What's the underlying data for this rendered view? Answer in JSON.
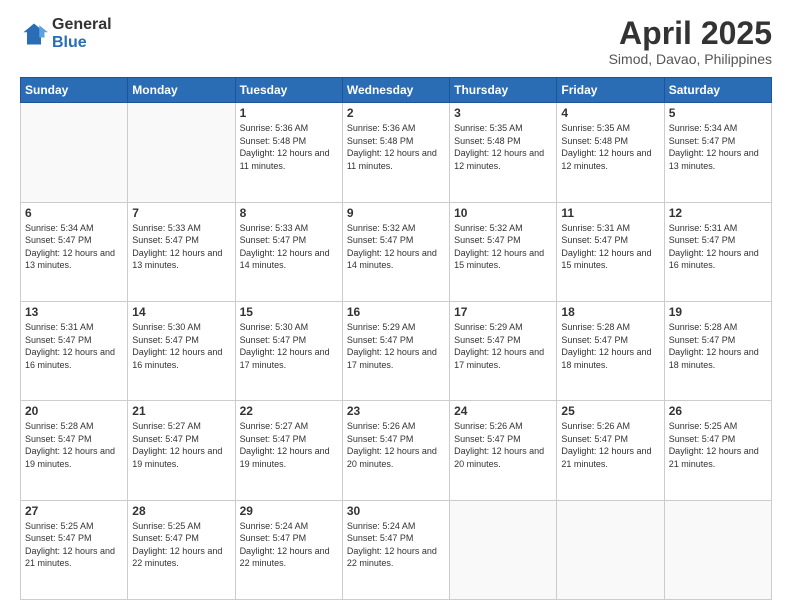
{
  "header": {
    "logo_general": "General",
    "logo_blue": "Blue",
    "title": "April 2025",
    "location": "Simod, Davao, Philippines"
  },
  "days_of_week": [
    "Sunday",
    "Monday",
    "Tuesday",
    "Wednesday",
    "Thursday",
    "Friday",
    "Saturday"
  ],
  "weeks": [
    [
      {
        "day": "",
        "sunrise": "",
        "sunset": "",
        "daylight": ""
      },
      {
        "day": "",
        "sunrise": "",
        "sunset": "",
        "daylight": ""
      },
      {
        "day": "1",
        "sunrise": "Sunrise: 5:36 AM",
        "sunset": "Sunset: 5:48 PM",
        "daylight": "Daylight: 12 hours and 11 minutes."
      },
      {
        "day": "2",
        "sunrise": "Sunrise: 5:36 AM",
        "sunset": "Sunset: 5:48 PM",
        "daylight": "Daylight: 12 hours and 11 minutes."
      },
      {
        "day": "3",
        "sunrise": "Sunrise: 5:35 AM",
        "sunset": "Sunset: 5:48 PM",
        "daylight": "Daylight: 12 hours and 12 minutes."
      },
      {
        "day": "4",
        "sunrise": "Sunrise: 5:35 AM",
        "sunset": "Sunset: 5:48 PM",
        "daylight": "Daylight: 12 hours and 12 minutes."
      },
      {
        "day": "5",
        "sunrise": "Sunrise: 5:34 AM",
        "sunset": "Sunset: 5:47 PM",
        "daylight": "Daylight: 12 hours and 13 minutes."
      }
    ],
    [
      {
        "day": "6",
        "sunrise": "Sunrise: 5:34 AM",
        "sunset": "Sunset: 5:47 PM",
        "daylight": "Daylight: 12 hours and 13 minutes."
      },
      {
        "day": "7",
        "sunrise": "Sunrise: 5:33 AM",
        "sunset": "Sunset: 5:47 PM",
        "daylight": "Daylight: 12 hours and 13 minutes."
      },
      {
        "day": "8",
        "sunrise": "Sunrise: 5:33 AM",
        "sunset": "Sunset: 5:47 PM",
        "daylight": "Daylight: 12 hours and 14 minutes."
      },
      {
        "day": "9",
        "sunrise": "Sunrise: 5:32 AM",
        "sunset": "Sunset: 5:47 PM",
        "daylight": "Daylight: 12 hours and 14 minutes."
      },
      {
        "day": "10",
        "sunrise": "Sunrise: 5:32 AM",
        "sunset": "Sunset: 5:47 PM",
        "daylight": "Daylight: 12 hours and 15 minutes."
      },
      {
        "day": "11",
        "sunrise": "Sunrise: 5:31 AM",
        "sunset": "Sunset: 5:47 PM",
        "daylight": "Daylight: 12 hours and 15 minutes."
      },
      {
        "day": "12",
        "sunrise": "Sunrise: 5:31 AM",
        "sunset": "Sunset: 5:47 PM",
        "daylight": "Daylight: 12 hours and 16 minutes."
      }
    ],
    [
      {
        "day": "13",
        "sunrise": "Sunrise: 5:31 AM",
        "sunset": "Sunset: 5:47 PM",
        "daylight": "Daylight: 12 hours and 16 minutes."
      },
      {
        "day": "14",
        "sunrise": "Sunrise: 5:30 AM",
        "sunset": "Sunset: 5:47 PM",
        "daylight": "Daylight: 12 hours and 16 minutes."
      },
      {
        "day": "15",
        "sunrise": "Sunrise: 5:30 AM",
        "sunset": "Sunset: 5:47 PM",
        "daylight": "Daylight: 12 hours and 17 minutes."
      },
      {
        "day": "16",
        "sunrise": "Sunrise: 5:29 AM",
        "sunset": "Sunset: 5:47 PM",
        "daylight": "Daylight: 12 hours and 17 minutes."
      },
      {
        "day": "17",
        "sunrise": "Sunrise: 5:29 AM",
        "sunset": "Sunset: 5:47 PM",
        "daylight": "Daylight: 12 hours and 17 minutes."
      },
      {
        "day": "18",
        "sunrise": "Sunrise: 5:28 AM",
        "sunset": "Sunset: 5:47 PM",
        "daylight": "Daylight: 12 hours and 18 minutes."
      },
      {
        "day": "19",
        "sunrise": "Sunrise: 5:28 AM",
        "sunset": "Sunset: 5:47 PM",
        "daylight": "Daylight: 12 hours and 18 minutes."
      }
    ],
    [
      {
        "day": "20",
        "sunrise": "Sunrise: 5:28 AM",
        "sunset": "Sunset: 5:47 PM",
        "daylight": "Daylight: 12 hours and 19 minutes."
      },
      {
        "day": "21",
        "sunrise": "Sunrise: 5:27 AM",
        "sunset": "Sunset: 5:47 PM",
        "daylight": "Daylight: 12 hours and 19 minutes."
      },
      {
        "day": "22",
        "sunrise": "Sunrise: 5:27 AM",
        "sunset": "Sunset: 5:47 PM",
        "daylight": "Daylight: 12 hours and 19 minutes."
      },
      {
        "day": "23",
        "sunrise": "Sunrise: 5:26 AM",
        "sunset": "Sunset: 5:47 PM",
        "daylight": "Daylight: 12 hours and 20 minutes."
      },
      {
        "day": "24",
        "sunrise": "Sunrise: 5:26 AM",
        "sunset": "Sunset: 5:47 PM",
        "daylight": "Daylight: 12 hours and 20 minutes."
      },
      {
        "day": "25",
        "sunrise": "Sunrise: 5:26 AM",
        "sunset": "Sunset: 5:47 PM",
        "daylight": "Daylight: 12 hours and 21 minutes."
      },
      {
        "day": "26",
        "sunrise": "Sunrise: 5:25 AM",
        "sunset": "Sunset: 5:47 PM",
        "daylight": "Daylight: 12 hours and 21 minutes."
      }
    ],
    [
      {
        "day": "27",
        "sunrise": "Sunrise: 5:25 AM",
        "sunset": "Sunset: 5:47 PM",
        "daylight": "Daylight: 12 hours and 21 minutes."
      },
      {
        "day": "28",
        "sunrise": "Sunrise: 5:25 AM",
        "sunset": "Sunset: 5:47 PM",
        "daylight": "Daylight: 12 hours and 22 minutes."
      },
      {
        "day": "29",
        "sunrise": "Sunrise: 5:24 AM",
        "sunset": "Sunset: 5:47 PM",
        "daylight": "Daylight: 12 hours and 22 minutes."
      },
      {
        "day": "30",
        "sunrise": "Sunrise: 5:24 AM",
        "sunset": "Sunset: 5:47 PM",
        "daylight": "Daylight: 12 hours and 22 minutes."
      },
      {
        "day": "",
        "sunrise": "",
        "sunset": "",
        "daylight": ""
      },
      {
        "day": "",
        "sunrise": "",
        "sunset": "",
        "daylight": ""
      },
      {
        "day": "",
        "sunrise": "",
        "sunset": "",
        "daylight": ""
      }
    ]
  ]
}
